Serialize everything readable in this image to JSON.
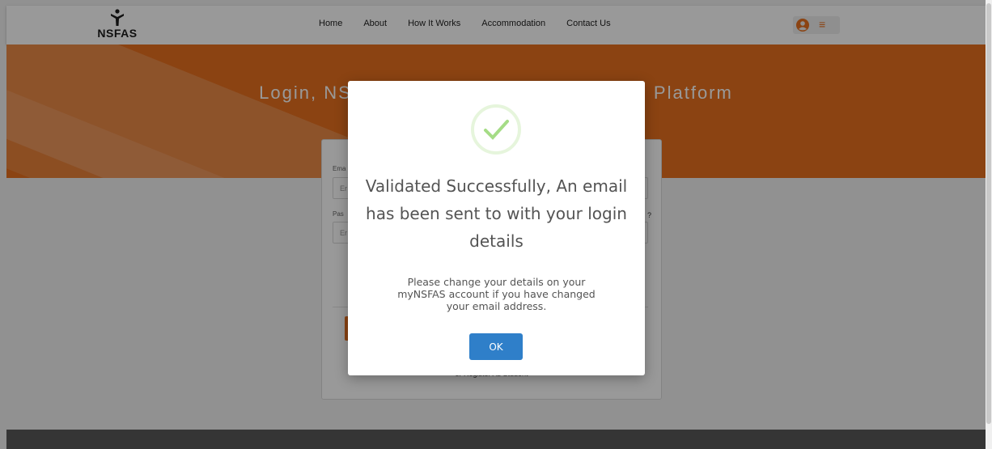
{
  "header": {
    "logo_text": "NSFAS",
    "nav": [
      "Home",
      "About",
      "How It Works",
      "Accommodation",
      "Contact Us"
    ],
    "menu_glyph": "≡"
  },
  "hero": {
    "title": "Login, NS                                              Platform"
  },
  "login_form": {
    "email_label": "Ema",
    "email_placeholder": "Er",
    "password_label": "Pas",
    "password_placeholder": "Er",
    "forgot_text": "?",
    "register_text": "or Register As Student"
  },
  "modal": {
    "title": "Validated Successfully, An email has been sent to with your login details",
    "message": "Please change your details on your myNSFAS account if you have changed your email address.",
    "ok_label": "OK"
  },
  "colors": {
    "brand_orange": "#e8711f",
    "ok_blue": "#2f7fc9",
    "success_green": "#a5dc86"
  }
}
